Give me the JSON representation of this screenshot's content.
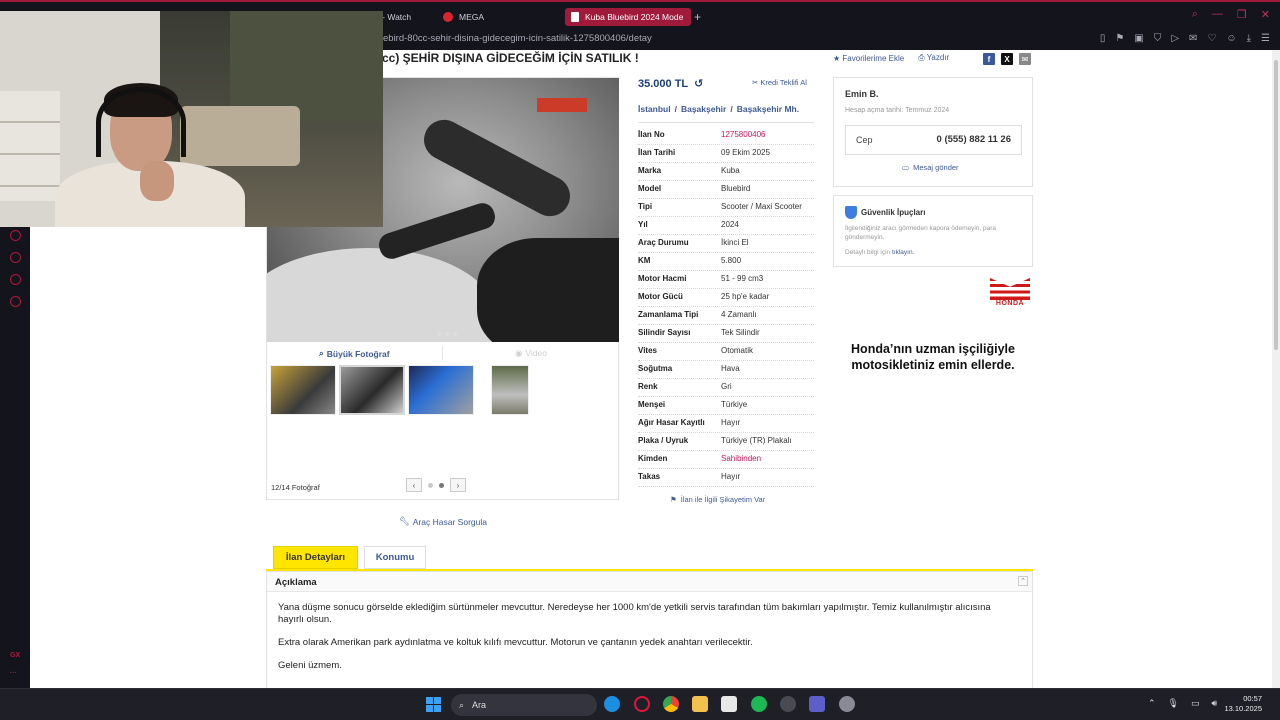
{
  "browser": {
    "tabs": [
      {
        "label": "am - Watch",
        "color": "#b0173a"
      },
      {
        "label": "MEGA",
        "color": "#d9262e"
      },
      {
        "label": "Kuba Bluebird 2024 Mode",
        "color": "#ffffff"
      }
    ],
    "url": "ebird-80cc-sehir-disina-gidecegim-icin-satilik-1275800406/detay"
  },
  "listing": {
    "title": "cc) ŞEHİR DIŞINA GİDECEĞİM İÇİN SATILIK !",
    "favorite_label": "Favorilerime Ekle",
    "print_label": "Yazdır",
    "price": "35.000 TL",
    "credit_label": "Kredi Teklifi Al",
    "location": [
      "İstanbul",
      "Başakşehir",
      "Başakşehir Mh."
    ],
    "big_photo_label": "Büyük Fotoğraf",
    "video_label": "Video",
    "photo_count": "12/14 Fotoğraf",
    "damage_query": "Araç Hasar Sorgula",
    "complaint": "İlan ile İlgili Şikayetim Var"
  },
  "specs": [
    {
      "k": "İlan No",
      "v": "1275800406",
      "red": true
    },
    {
      "k": "İlan Tarihi",
      "v": "09 Ekim 2025"
    },
    {
      "k": "Marka",
      "v": "Kuba"
    },
    {
      "k": "Model",
      "v": "Bluebird"
    },
    {
      "k": "Tipi",
      "v": "Scooter / Maxi Scooter"
    },
    {
      "k": "Yıl",
      "v": "2024"
    },
    {
      "k": "Araç Durumu",
      "v": "İkinci El"
    },
    {
      "k": "KM",
      "v": "5.800"
    },
    {
      "k": "Motor Hacmi",
      "v": "51 - 99 cm3"
    },
    {
      "k": "Motor Gücü",
      "v": "25 hp'e kadar"
    },
    {
      "k": "Zamanlama Tipi",
      "v": "4 Zamanlı"
    },
    {
      "k": "Silindir Sayısı",
      "v": "Tek Silindir"
    },
    {
      "k": "Vites",
      "v": "Otomatik"
    },
    {
      "k": "Soğutma",
      "v": "Hava"
    },
    {
      "k": "Renk",
      "v": "Gri"
    },
    {
      "k": "Menşei",
      "v": "Türkiye"
    },
    {
      "k": "Ağır Hasar Kayıtlı",
      "v": "Hayır"
    },
    {
      "k": "Plaka / Uyruk",
      "v": "Türkiye (TR) Plakalı"
    },
    {
      "k": "Kimden",
      "v": "Sahibinden",
      "red": true
    },
    {
      "k": "Takas",
      "v": "Hayır"
    }
  ],
  "seller": {
    "name": "Emin B.",
    "since": "Hesap açma tarihi: Temmuz 2024",
    "phone_label": "Cep",
    "phone": "0 (555) 882 11 26",
    "message_label": "Mesaj gönder"
  },
  "tips": {
    "title": "Güvenlik İpuçları",
    "text": "İlgilendiğiniz aracı görmeden kapora ödemeyin, para göndermeyin.",
    "more_prefix": "Detaylı bilgi için",
    "more_link": "tıklayın."
  },
  "ad": {
    "brand": "HONDA",
    "text": "Honda’nın uzman işçiliğiyle motosikletiniz emin ellerde."
  },
  "tabs": {
    "detail": "İlan Detayları",
    "location": "Konumu"
  },
  "description": {
    "heading": "Açıklama",
    "p1": "Yana düşme sonucu görselde eklediğim sürtünmeler mevcuttur. Neredeyse her 1000 km'de yetkili servis tarafından tüm bakımları yapılmıştır. Temiz kullanılmıştır alıcısına hayırlı olsun.",
    "p2": "Extra olarak Amerikan park aydınlatma ve koltuk kılıfı mevcuttur. Motorun ve çantanın yedek anahtarı verilecektir.",
    "p3": "Geleni üzmem."
  },
  "sidebar": {
    "gx_label": "GX"
  },
  "taskbar": {
    "search_placeholder": "Ara",
    "time": "00:57",
    "date": "13.10.2025"
  }
}
